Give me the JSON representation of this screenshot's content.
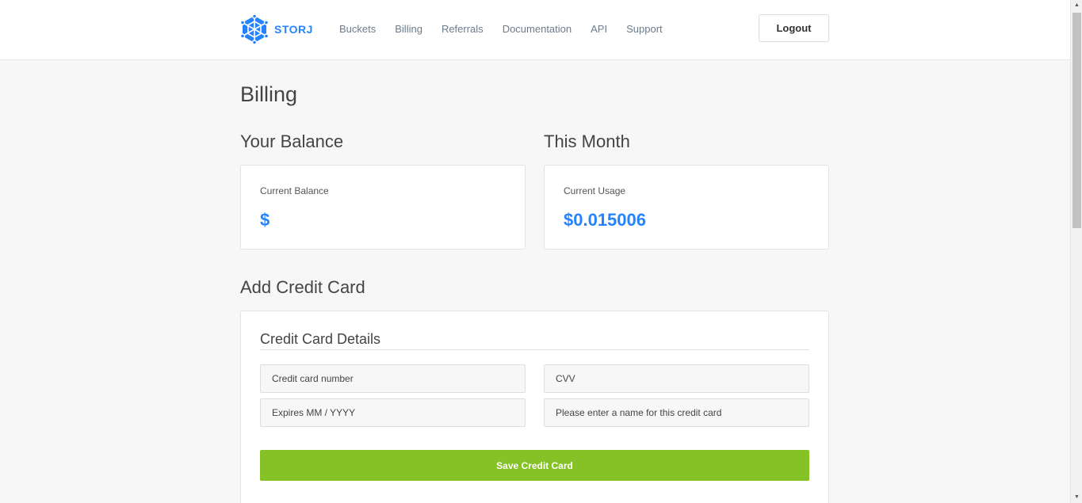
{
  "header": {
    "logo_text": "STORJ",
    "nav": [
      "Buckets",
      "Billing",
      "Referrals",
      "Documentation",
      "API",
      "Support"
    ],
    "logout_label": "Logout"
  },
  "page": {
    "title": "Billing"
  },
  "balance": {
    "heading": "Your Balance",
    "label": "Current Balance",
    "value": "$"
  },
  "month": {
    "heading": "This Month",
    "label": "Current Usage",
    "value": "$0.015006"
  },
  "credit_card": {
    "heading": "Add Credit Card",
    "details_title": "Credit Card Details",
    "number_placeholder": "Credit card number",
    "cvv_placeholder": "CVV",
    "expiry_placeholder": "Expires MM / YYYY",
    "name_placeholder": "Please enter a name for this credit card",
    "save_label": "Save Credit Card"
  },
  "colors": {
    "brand": "#2683ff",
    "save_button": "#85c226"
  },
  "icons": {
    "logo": "storj-logo-icon",
    "scroll_up": "arrow-up-icon",
    "scroll_down": "arrow-down-icon"
  }
}
